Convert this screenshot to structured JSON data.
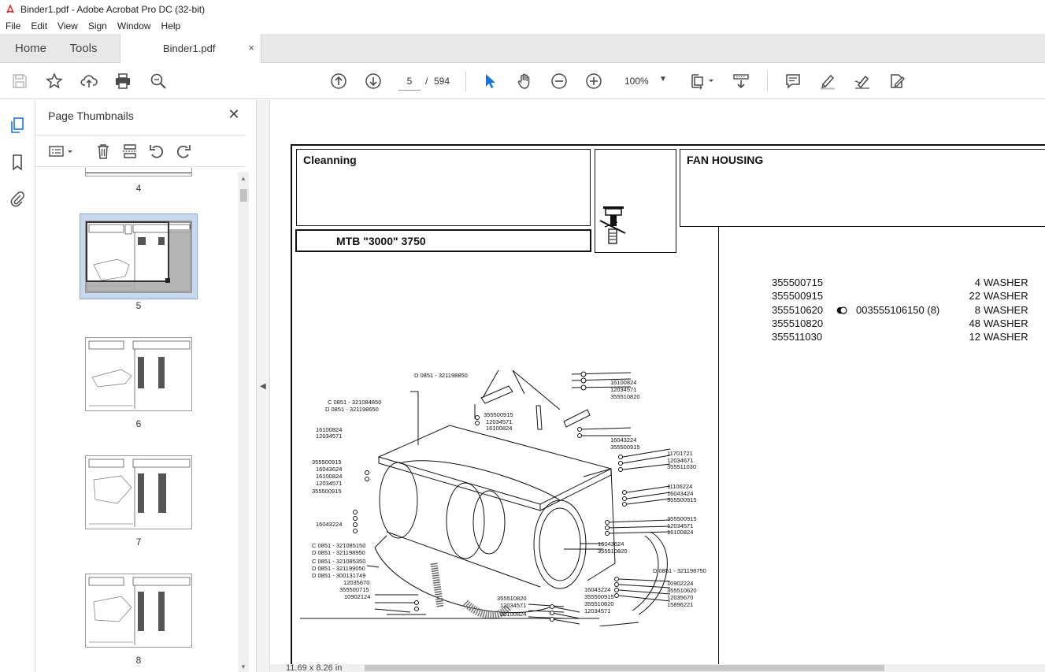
{
  "window": {
    "title": "Binder1.pdf - Adobe Acrobat Pro DC (32-bit)"
  },
  "menu": [
    "File",
    "Edit",
    "View",
    "Sign",
    "Window",
    "Help"
  ],
  "tabs": {
    "home": "Home",
    "tools": "Tools",
    "document": "Binder1.pdf",
    "close_glyph": "×"
  },
  "toolbar": {
    "page_current": "5",
    "page_separator": "/",
    "page_total": "594",
    "zoom": "100%"
  },
  "thumbnails_panel": {
    "title": "Page Thumbnails",
    "close_glyph": "✕",
    "thumbs": [
      {
        "label": "4",
        "selected": false
      },
      {
        "label": "5",
        "selected": true
      },
      {
        "label": "6",
        "selected": false
      },
      {
        "label": "7",
        "selected": false
      },
      {
        "label": "8",
        "selected": false
      }
    ]
  },
  "document": {
    "header_left": "Cleanning",
    "header_right": "FAN HOUSING",
    "model": "MTB \"3000\" 3750",
    "parts": [
      {
        "code": "355500715",
        "alt": "",
        "qty": "4",
        "desc": "WASHER"
      },
      {
        "code": "355500915",
        "alt": "",
        "qty": "22",
        "desc": "WASHER"
      },
      {
        "code": "355510620",
        "alt": "003555106150  (8)",
        "qty": "8",
        "desc": "WASHER",
        "marker": true
      },
      {
        "code": "355510820",
        "alt": "",
        "qty": "48",
        "desc": "WASHER"
      },
      {
        "code": "355511030",
        "alt": "",
        "qty": "12",
        "desc": "WASHER"
      }
    ],
    "drawing_labels": [
      "D 0851 - 321198850",
      "16100824",
      "12034571",
      "355510820",
      "C 0851 - 321084850",
      "D 0851 - 321198650",
      "355500915",
      "12034571",
      "16100824",
      "16100824",
      "12034571",
      "16043224",
      "355500915",
      "11701721",
      "12034671",
      "355511030",
      "355500915",
      "16043624",
      "16100824",
      "12034571",
      "355500915",
      "11106224",
      "16043424",
      "355500915",
      "16043224",
      "355500915",
      "12034571",
      "16100824",
      "16043624",
      "355510820",
      "C 0851 - 321085150",
      "D 0851 - 321198950",
      "D 0851 - 321198750",
      "C 0851 - 321085350",
      "D 0851 - 321199050",
      "D 0851 - 300131749",
      "12035670",
      "355500715",
      "10902124",
      "16043224",
      "355500915",
      "355510820",
      "12034571",
      "10902224",
      "355510620",
      "12035670",
      "15896221",
      "355510820",
      "12034571",
      "16100824"
    ]
  },
  "status": {
    "page_size": "11.69 x 8.26 in"
  },
  "colors": {
    "accent_blue": "#1473e6",
    "selected_thumb": "#c8d8ee",
    "icon": "#4a4a4a"
  }
}
